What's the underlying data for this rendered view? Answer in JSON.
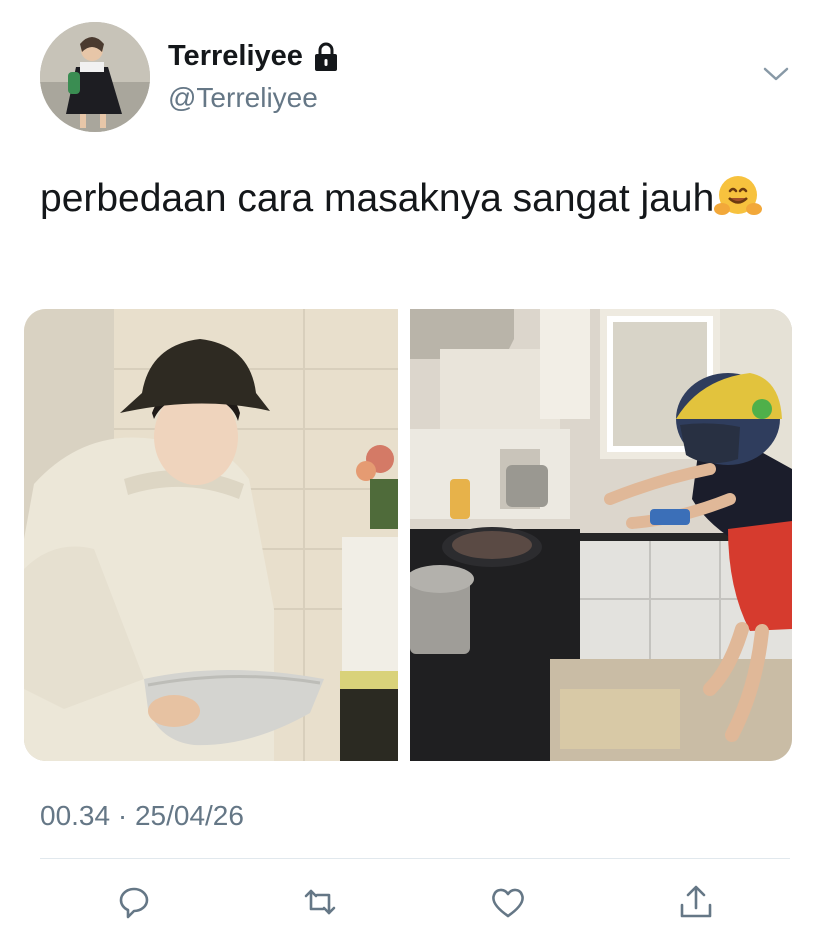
{
  "tweet": {
    "author": {
      "display_name": "Terreliyee",
      "handle": "@Terreliyee",
      "verified_icon": "lock-icon",
      "avatar_icon": "avatar"
    },
    "text": "perbedaan cara masaknya sangat jauh",
    "emoji_icon": "hugging-face-emoji",
    "timestamp": "00.34 · 25/04/26",
    "media": [
      {
        "kind": "photo",
        "icon": "photo-person-cooking-calm"
      },
      {
        "kind": "photo",
        "icon": "photo-person-cooking-helmet"
      }
    ],
    "actions": [
      {
        "name": "reply-icon"
      },
      {
        "name": "retweet-icon"
      },
      {
        "name": "like-icon"
      },
      {
        "name": "share-icon"
      }
    ],
    "colors": {
      "primary_text": "#14171a",
      "secondary_text": "#657786",
      "divider": "#e1e8ed"
    }
  }
}
